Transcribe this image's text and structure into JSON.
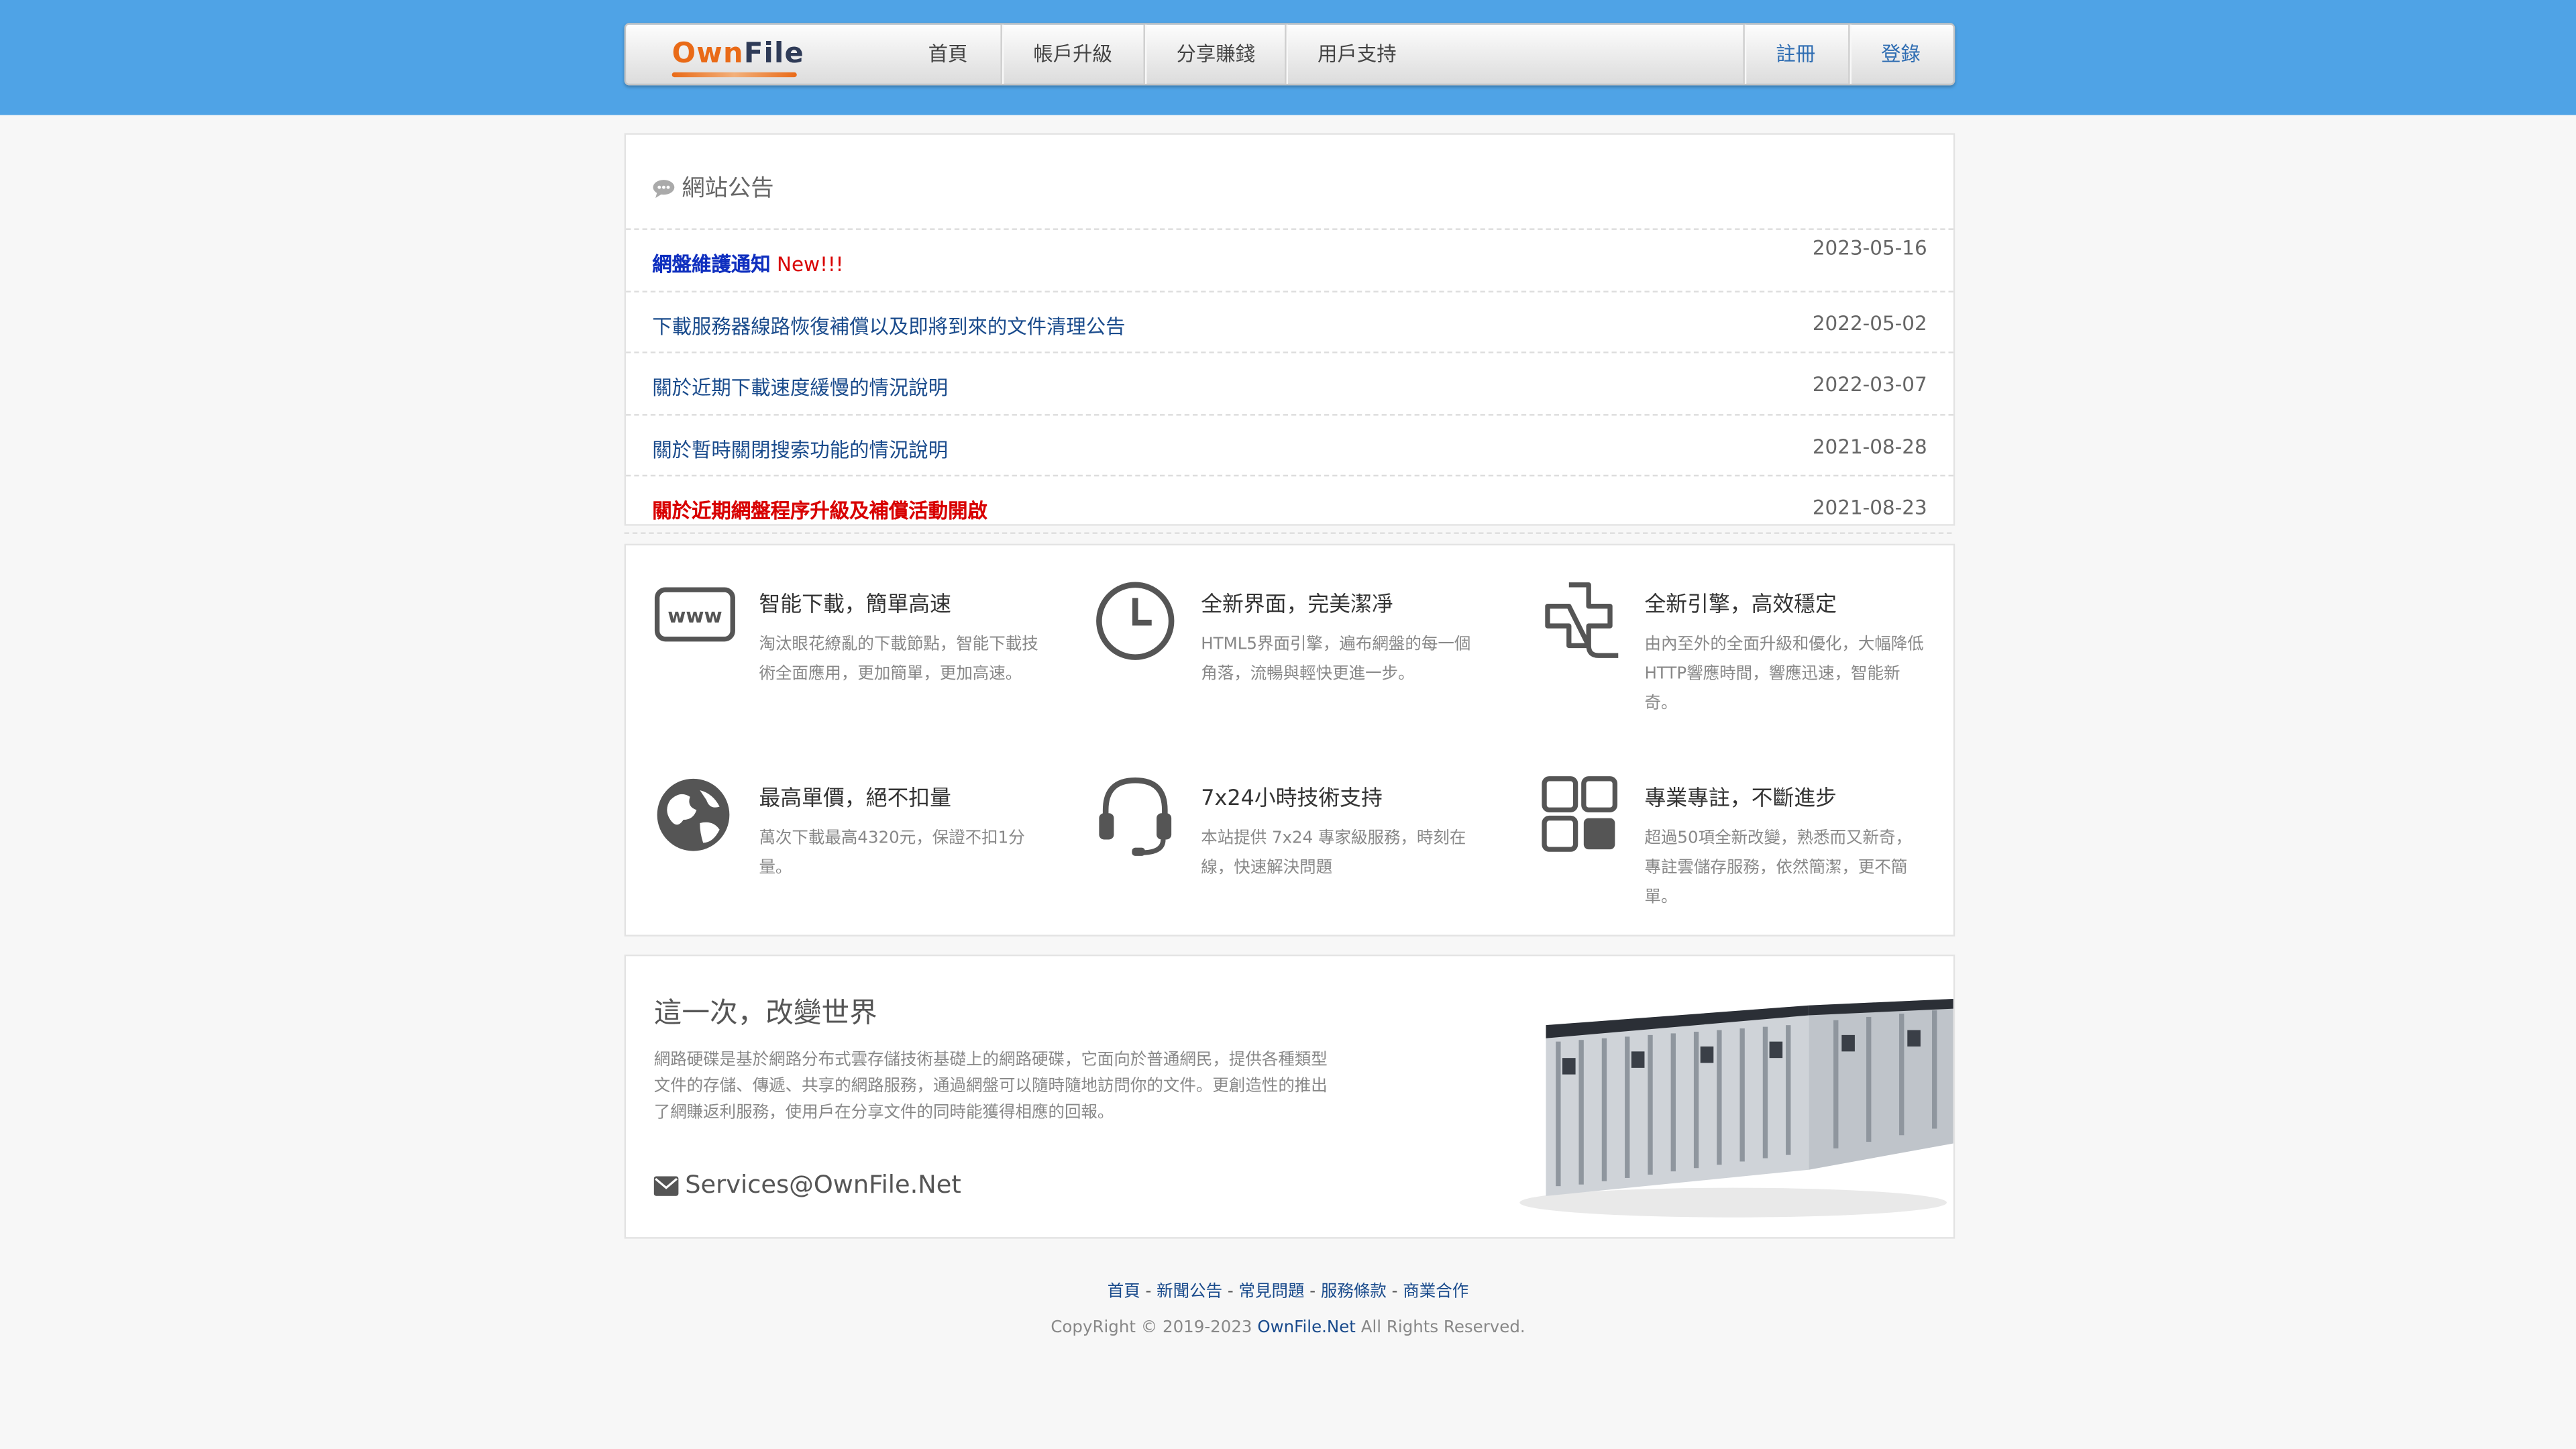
{
  "nav": {
    "logo_part1": "Own",
    "logo_part2": "File",
    "items": [
      "首頁",
      "帳戶升級",
      "分享賺錢",
      "用戶支持"
    ],
    "register": "註冊",
    "login": "登錄"
  },
  "notices": {
    "title": "網站公告",
    "rows": [
      {
        "title": "網盤維護通知",
        "badge": "New!!!",
        "date": "2023-05-16"
      },
      {
        "title": "下載服務器線路恢復補償以及即將到來的文件清理公告",
        "date": "2022-05-02"
      },
      {
        "title": "關於近期下載速度緩慢的情況說明",
        "date": "2022-03-07"
      },
      {
        "title": "關於暫時關閉搜索功能的情況說明",
        "date": "2021-08-28"
      },
      {
        "title": "關於近期網盤程序升級及補償活動開啟",
        "date": "2021-08-23"
      }
    ]
  },
  "features": [
    {
      "icon": "www-icon",
      "title": "智能下載，簡單高速",
      "desc": "淘汰眼花繚亂的下載節點，智能下載技術全面應用，更加簡單，更加高速。"
    },
    {
      "icon": "clock-icon",
      "title": "全新界面，完美潔凈",
      "desc": "HTML5界面引擎，遍布網盤的每一個角落，流暢與輕快更進一步。"
    },
    {
      "icon": "engine-icon",
      "title": "全新引擎，高效穩定",
      "desc": "由內至外的全面升級和優化，大幅降低HTTP響應時間，響應迅速，智能新奇。"
    },
    {
      "icon": "globe-icon",
      "title": "最高單價，絕不扣量",
      "desc": "萬次下載最高4320元，保證不扣1分量。"
    },
    {
      "icon": "headset-icon",
      "title": "7x24小時技術支持",
      "desc": "本站提供 7x24 專家級服務，時刻在線，快速解決問題"
    },
    {
      "icon": "grid-icon",
      "title": "專業專註，不斷進步",
      "desc": "超過50項全新改變，熟悉而又新奇，專註雲儲存服務，依然簡潔，更不簡單。"
    }
  ],
  "promo": {
    "title": "這一次，改變世界",
    "text": "網路硬碟是基於網路分布式雲存儲技術基礎上的網路硬碟，它面向於普通網民，提供各種類型文件的存儲、傳遞、共享的網路服務，通過網盤可以隨時隨地訪問你的文件。更創造性的推出了網賺返利服務，使用戶在分享文件的同時能獲得相應的回報。",
    "email": "Services@OwnFile.Net"
  },
  "footer": {
    "links": [
      "首頁",
      "新聞公告",
      "常見問題",
      "服務條款",
      "商業合作"
    ],
    "copy_prefix": "CopyRight © 2019-2023",
    "brand": "OwnFile.Net",
    "copy_suffix": "All Rights Reserved."
  },
  "colors": {
    "top_band": "#4fa3e6",
    "logo_orange": "#e96a17",
    "link_blue": "#1a4b8c",
    "alert_red": "#d80000",
    "new_blue": "#0f2fbf"
  }
}
